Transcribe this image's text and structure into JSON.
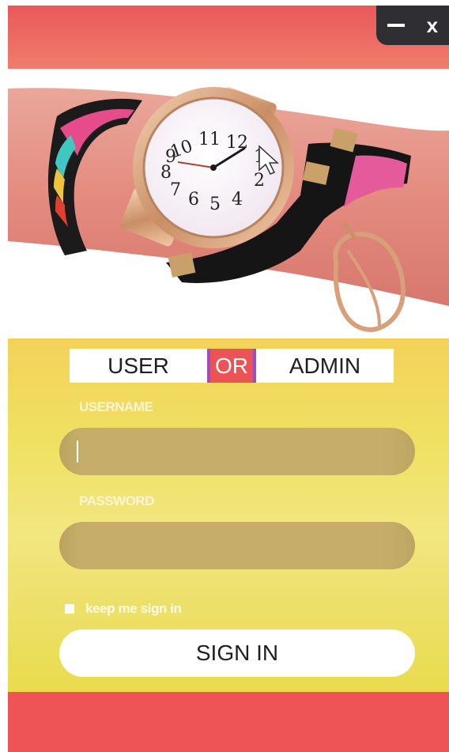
{
  "window": {
    "minimize_label": "—",
    "close_label": "x"
  },
  "hero": {
    "image": "watch-on-wrist-photo",
    "dial_numbers": [
      "10",
      "11",
      "12",
      "1",
      "2",
      "4",
      "5",
      "6",
      "7",
      "8",
      "9"
    ]
  },
  "role_switch": {
    "user_label": "USER",
    "or_label": "OR",
    "admin_label": "ADMIN"
  },
  "form": {
    "username_label": "USERNAME",
    "username_value": "",
    "password_label": "PASSWORD",
    "password_value": "",
    "keep_signed_in_label": "keep me sign in",
    "keep_signed_in_checked": false,
    "signin_label": "SIGN IN"
  },
  "colors": {
    "header_red": "#ec5356",
    "form_yellow": "#efe162",
    "field_tan": "#c6ad6a",
    "divider_purple": "#9a4ec4",
    "control_dark": "#2f2f33"
  }
}
